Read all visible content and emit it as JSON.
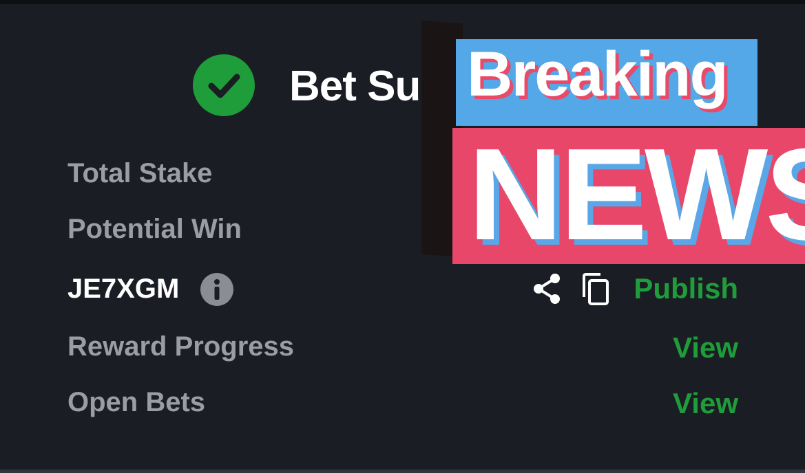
{
  "header": {
    "title": "Bet Successful"
  },
  "rows": {
    "total_stake": {
      "label": "Total Stake"
    },
    "potential_win": {
      "label": "Potential Win"
    },
    "booking": {
      "code": "JE7XGM",
      "publish_label": "Publish"
    },
    "reward_progress": {
      "label": "Reward Progress",
      "action": "View"
    },
    "open_bets": {
      "label": "Open Bets",
      "action": "View"
    }
  },
  "overlay": {
    "line1": "Breaking",
    "line2": "NEWS"
  },
  "icons": {
    "status": "check-circle-icon",
    "info": "info-icon",
    "share": "share-icon",
    "copy": "copy-icon"
  },
  "colors": {
    "background": "#1b1d24",
    "success_green": "#1f9d3a",
    "muted_text": "#9a9ca6",
    "sticker_blue": "#55a8e8",
    "sticker_red": "#e8476a"
  }
}
